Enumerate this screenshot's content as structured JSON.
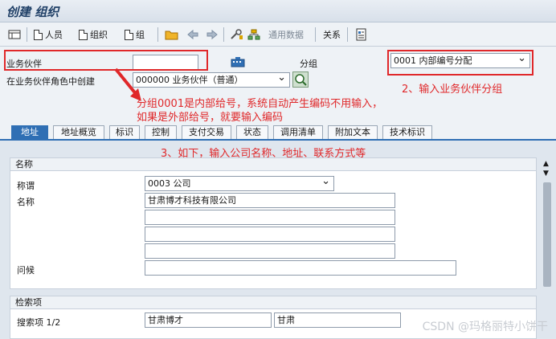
{
  "title": "创建 组织",
  "toolbar": {
    "person": "人员",
    "org": "组织",
    "group": "组",
    "general_data": "通用数据",
    "relations": "关系"
  },
  "header": {
    "bp_label": "业务伙伴",
    "bp_value": "",
    "grouping_label": "分组",
    "grouping_value": "0001 内部编号分配",
    "role_label": "在业务伙伴角色中创建",
    "role_value": "000000 业务伙伴（普通）"
  },
  "annotations": {
    "a1": "2、输入业务伙伴分组",
    "a2_line1": "分组0001是内部给号，系统自动产生编码不用输入，",
    "a2_line2": "如果是外部给号，就要输入编码",
    "a3": "3、如下，输入公司名称、地址、联系方式等"
  },
  "tabs": [
    "地址",
    "地址概览",
    "标识",
    "控制",
    "支付交易",
    "状态",
    "调用清单",
    "附加文本",
    "技术标识"
  ],
  "name_group": {
    "title": "名称",
    "salutation_label": "称谓",
    "salutation_value": "0003 公司",
    "name_label": "名称",
    "name1": "甘肃博才科技有限公司",
    "name2": "",
    "name3": "",
    "name4": "",
    "greeting_label": "问候",
    "greeting_value": ""
  },
  "search_group": {
    "title": "检索项",
    "label": "搜索项 1/2",
    "value1": "甘肃博才",
    "value2": "甘肃"
  },
  "watermark": "CSDN @玛格丽特小饼干",
  "colors": {
    "accent": "#2f6fb4",
    "annotation": "#e0282a"
  }
}
